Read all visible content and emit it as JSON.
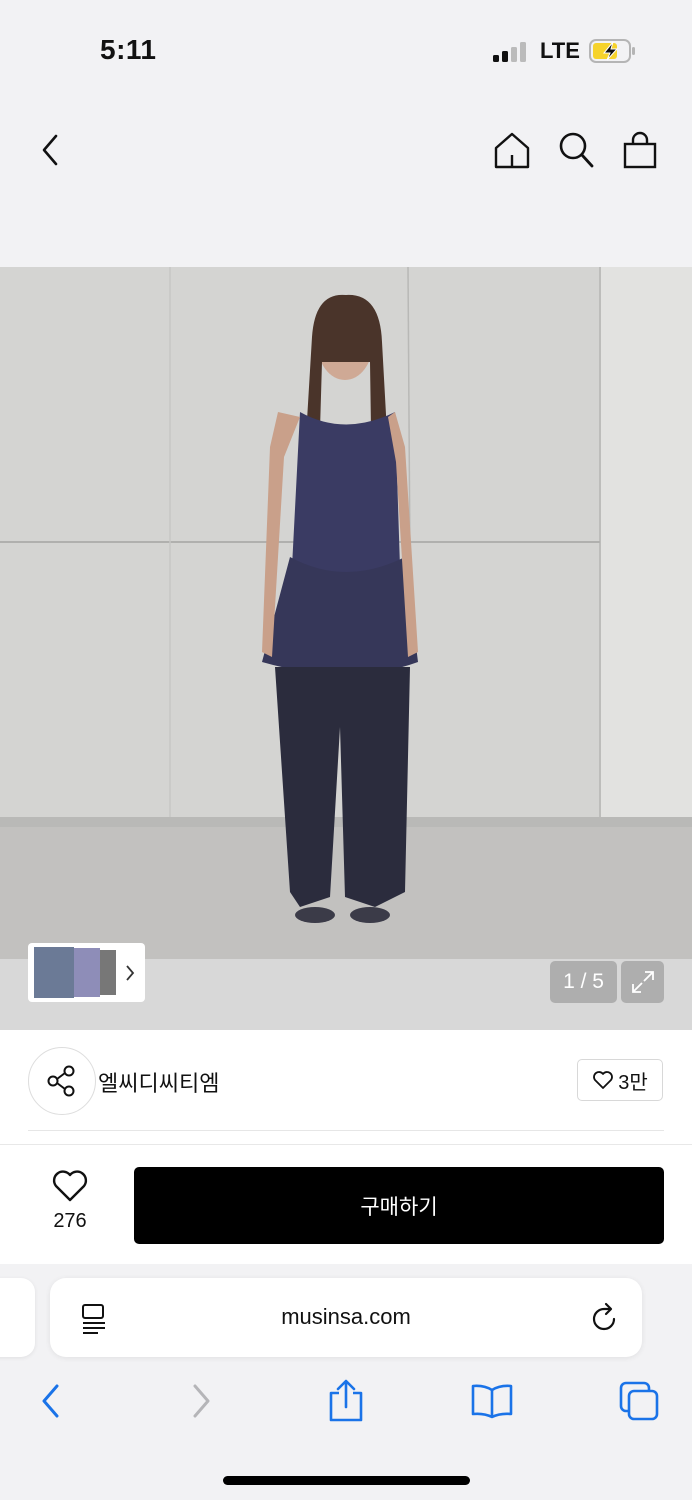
{
  "status": {
    "time": "5:11",
    "network": "LTE"
  },
  "gallery": {
    "counter": "1 / 5"
  },
  "brand": {
    "name": "엘씨디씨티엠",
    "likes": "3만"
  },
  "purchase": {
    "wish_count": "276",
    "buy_label": "구매하기"
  },
  "browser": {
    "url": "musinsa.com"
  },
  "colors": {
    "battery_fill": "#f6d32c",
    "safari_blue": "#1a73e8",
    "buy_button": "#000000"
  },
  "icons": [
    "back-icon",
    "home-icon",
    "search-icon",
    "shopping-bag-icon",
    "expand-icon",
    "share-icon",
    "heart-icon",
    "reader-icon",
    "reload-icon",
    "share-sheet-icon",
    "bookmarks-icon",
    "tabs-icon"
  ]
}
